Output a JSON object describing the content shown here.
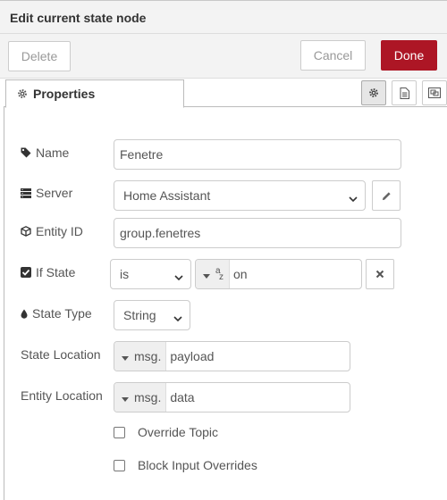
{
  "tray": {
    "title": "Edit current state node",
    "delete_label": "Delete",
    "cancel_label": "Cancel",
    "done_label": "Done"
  },
  "tabs": {
    "properties_label": "Properties"
  },
  "form": {
    "name": {
      "label": "Name",
      "value": "Fenetre"
    },
    "server": {
      "label": "Server",
      "value": "Home Assistant"
    },
    "entity_id": {
      "label": "Entity ID",
      "value": "group.fenetres"
    },
    "if_state": {
      "label": "If State",
      "operator": "is",
      "type_prefix": "a",
      "type_sub": "z",
      "value": "on"
    },
    "state_type": {
      "label": "State Type",
      "value": "String"
    },
    "state_location": {
      "label": "State Location",
      "prefix": "msg.",
      "value": "payload"
    },
    "entity_location": {
      "label": "Entity Location",
      "prefix": "msg.",
      "value": "data"
    },
    "override_topic": {
      "label": "Override Topic",
      "checked": false
    },
    "block_input_overrides": {
      "label": "Block Input Overrides",
      "checked": false
    }
  },
  "colors": {
    "done_button": "#ad1625",
    "header_bg": "#f3f3f3",
    "border": "#cccccc"
  }
}
